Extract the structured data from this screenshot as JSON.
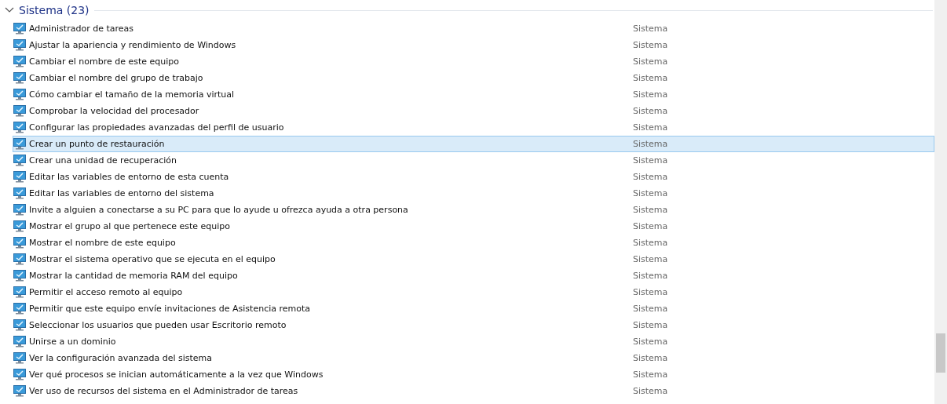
{
  "group": {
    "title": "Sistema (23)",
    "expanded": true
  },
  "items": [
    {
      "name": "Administrador de tareas",
      "category": "Sistema",
      "selected": false
    },
    {
      "name": "Ajustar la apariencia y rendimiento de Windows",
      "category": "Sistema",
      "selected": false
    },
    {
      "name": "Cambiar el nombre de este equipo",
      "category": "Sistema",
      "selected": false
    },
    {
      "name": "Cambiar el nombre del grupo de trabajo",
      "category": "Sistema",
      "selected": false
    },
    {
      "name": "Cómo cambiar el tamaño de la memoria virtual",
      "category": "Sistema",
      "selected": false
    },
    {
      "name": "Comprobar la velocidad del procesador",
      "category": "Sistema",
      "selected": false
    },
    {
      "name": "Configurar las propiedades avanzadas del perfil de usuario",
      "category": "Sistema",
      "selected": false
    },
    {
      "name": "Crear un punto de restauración",
      "category": "Sistema",
      "selected": true
    },
    {
      "name": "Crear una unidad de recuperación",
      "category": "Sistema",
      "selected": false
    },
    {
      "name": "Editar las variables de entorno de esta cuenta",
      "category": "Sistema",
      "selected": false
    },
    {
      "name": "Editar las variables de entorno del sistema",
      "category": "Sistema",
      "selected": false
    },
    {
      "name": "Invite a alguien a conectarse a su PC para que lo ayude u ofrezca ayuda a otra persona",
      "category": "Sistema",
      "selected": false
    },
    {
      "name": "Mostrar el grupo al que pertenece este equipo",
      "category": "Sistema",
      "selected": false
    },
    {
      "name": "Mostrar el nombre de este equipo",
      "category": "Sistema",
      "selected": false
    },
    {
      "name": "Mostrar el sistema operativo que se ejecuta en el equipo",
      "category": "Sistema",
      "selected": false
    },
    {
      "name": "Mostrar la cantidad de memoria RAM del equipo",
      "category": "Sistema",
      "selected": false
    },
    {
      "name": "Permitir el acceso remoto al equipo",
      "category": "Sistema",
      "selected": false
    },
    {
      "name": "Permitir que este equipo envíe invitaciones de Asistencia remota",
      "category": "Sistema",
      "selected": false
    },
    {
      "name": "Seleccionar los usuarios que pueden usar Escritorio remoto",
      "category": "Sistema",
      "selected": false
    },
    {
      "name": "Unirse a un dominio",
      "category": "Sistema",
      "selected": false
    },
    {
      "name": "Ver la configuración avanzada del sistema",
      "category": "Sistema",
      "selected": false
    },
    {
      "name": "Ver qué procesos se inician automáticamente a la vez que Windows",
      "category": "Sistema",
      "selected": false
    },
    {
      "name": "Ver uso de recursos del sistema en el Administrador de tareas",
      "category": "Sistema",
      "selected": false
    }
  ]
}
